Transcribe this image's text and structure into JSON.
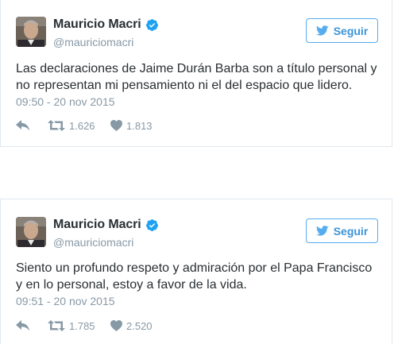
{
  "tweets": [
    {
      "author": {
        "name": "Mauricio Macri",
        "handle": "@mauriciomacri",
        "verified": true
      },
      "follow_label": "Seguir",
      "text": "Las declaraciones de Jaime Durán Barba son a título personal y no representan mi pensamiento ni el del espacio que lidero.",
      "timestamp": "09:50 - 20 nov 2015",
      "retweets": "1.626",
      "likes": "1.813"
    },
    {
      "author": {
        "name": "Mauricio Macri",
        "handle": "@mauriciomacri",
        "verified": true
      },
      "follow_label": "Seguir",
      "text": "Siento un profundo respeto y admiración por el Papa Francisco y en lo personal, estoy a favor de la vida.",
      "timestamp": "09:51 - 20 nov 2015",
      "retweets": "1.785",
      "likes": "2.520"
    }
  ],
  "colors": {
    "brand": "#55acee",
    "text": "#292f33",
    "muted": "#8899a6",
    "border": "#e1e8ed"
  },
  "icons": [
    "twitter-bird-icon",
    "verified-badge-icon",
    "reply-icon",
    "retweet-icon",
    "heart-icon"
  ]
}
